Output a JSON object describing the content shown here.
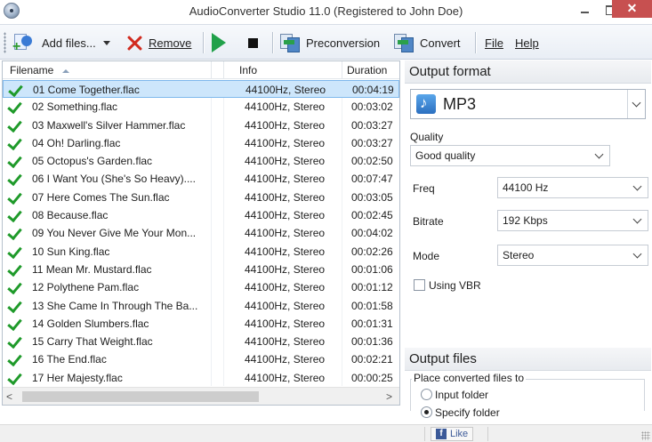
{
  "window": {
    "title": "AudioConverter Studio 11.0 (Registered to John Doe)",
    "close_glyph": "✕"
  },
  "toolbar": {
    "add_files_label": "Add files...",
    "remove_label": "Remove",
    "preconversion_label": "Preconversion",
    "convert_label": "Convert",
    "file_menu_label": "File",
    "help_menu_label": "Help"
  },
  "file_list": {
    "columns": {
      "filename": "Filename",
      "info": "Info",
      "duration": "Duration"
    },
    "sort_column": "filename",
    "sort_direction": "ascending",
    "selected_index": 0,
    "rows": [
      {
        "name": "01 Come Together.flac",
        "info": "44100Hz, Stereo",
        "duration": "00:04:19"
      },
      {
        "name": "02 Something.flac",
        "info": "44100Hz, Stereo",
        "duration": "00:03:02"
      },
      {
        "name": "03 Maxwell's Silver Hammer.flac",
        "info": "44100Hz, Stereo",
        "duration": "00:03:27"
      },
      {
        "name": "04 Oh! Darling.flac",
        "info": "44100Hz, Stereo",
        "duration": "00:03:27"
      },
      {
        "name": "05 Octopus's Garden.flac",
        "info": "44100Hz, Stereo",
        "duration": "00:02:50"
      },
      {
        "name": "06 I Want You (She's So Heavy)....",
        "info": "44100Hz, Stereo",
        "duration": "00:07:47"
      },
      {
        "name": "07 Here Comes The Sun.flac",
        "info": "44100Hz, Stereo",
        "duration": "00:03:05"
      },
      {
        "name": "08 Because.flac",
        "info": "44100Hz, Stereo",
        "duration": "00:02:45"
      },
      {
        "name": "09 You Never Give Me Your Mon...",
        "info": "44100Hz, Stereo",
        "duration": "00:04:02"
      },
      {
        "name": "10 Sun King.flac",
        "info": "44100Hz, Stereo",
        "duration": "00:02:26"
      },
      {
        "name": "11 Mean Mr. Mustard.flac",
        "info": "44100Hz, Stereo",
        "duration": "00:01:06"
      },
      {
        "name": "12 Polythene Pam.flac",
        "info": "44100Hz, Stereo",
        "duration": "00:01:12"
      },
      {
        "name": "13 She Came In Through The Ba...",
        "info": "44100Hz, Stereo",
        "duration": "00:01:58"
      },
      {
        "name": "14 Golden Slumbers.flac",
        "info": "44100Hz, Stereo",
        "duration": "00:01:31"
      },
      {
        "name": "15 Carry That Weight.flac",
        "info": "44100Hz, Stereo",
        "duration": "00:01:36"
      },
      {
        "name": "16 The End.flac",
        "info": "44100Hz, Stereo",
        "duration": "00:02:21"
      },
      {
        "name": "17 Her Majesty.flac",
        "info": "44100Hz, Stereo",
        "duration": "00:00:25"
      }
    ],
    "scroll_left_glyph": "<",
    "scroll_right_glyph": ">"
  },
  "output_format": {
    "header": "Output format",
    "format_name": "MP3",
    "quality_label": "Quality",
    "quality_value": "Good quality",
    "freq_label": "Freq",
    "freq_value": "44100 Hz",
    "bitrate_label": "Bitrate",
    "bitrate_value": "192 Kbps",
    "mode_label": "Mode",
    "mode_value": "Stereo",
    "vbr_label": "Using VBR",
    "vbr_checked": false
  },
  "output_files": {
    "header": "Output files",
    "group_label": "Place converted files to",
    "option_input_folder": "Input folder",
    "option_specify_folder": "Specify folder",
    "selected_option": "specify_folder"
  },
  "statusbar": {
    "like_label": "Like",
    "fb_glyph": "f"
  },
  "colors": {
    "selection_bg": "#cde6fb",
    "check_green": "#1f9a2a",
    "play_green": "#21a14a",
    "remove_red": "#d12b1f",
    "close_red": "#c75050",
    "facebook_blue": "#3b5998"
  }
}
